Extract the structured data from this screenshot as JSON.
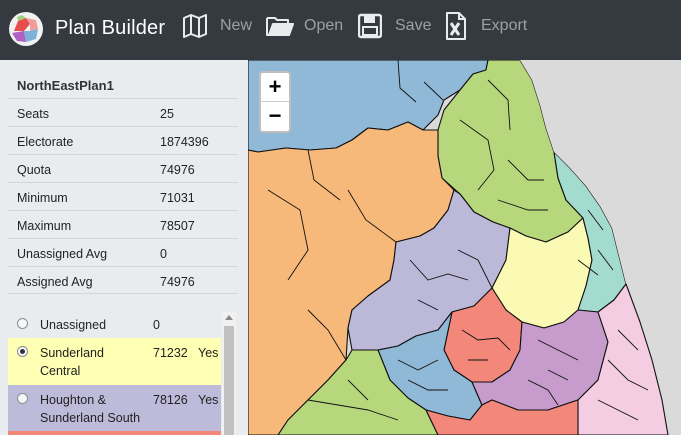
{
  "app": {
    "title": "Plan Builder"
  },
  "toolbar": {
    "new": "New",
    "open": "Open",
    "save": "Save",
    "export": "Export"
  },
  "plan": {
    "name": "NorthEastPlan1",
    "stats": [
      {
        "key": "Seats",
        "value": "25"
      },
      {
        "key": "Electorate",
        "value": "1874396"
      },
      {
        "key": "Quota",
        "value": "74976"
      },
      {
        "key": "Minimum",
        "value": "71031"
      },
      {
        "key": "Maximum",
        "value": "78507"
      },
      {
        "key": "Unassigned Avg",
        "value": "0"
      },
      {
        "key": "Assigned Avg",
        "value": "74976"
      }
    ]
  },
  "constituencies": [
    {
      "name": "Unassigned",
      "population": "0",
      "status": "",
      "color": "#e9ecef",
      "selected": false
    },
    {
      "name": "Sunderland Central",
      "population": "71232",
      "status": "Yes",
      "color": "#ffffb3",
      "selected": true
    },
    {
      "name": "Houghton & Sunderland South",
      "population": "78126",
      "status": "Yes",
      "color": "#bebada",
      "selected": false
    }
  ],
  "map": {
    "zoom_in": "+",
    "zoom_out": "−",
    "colors": {
      "blue": "#8fb9d6",
      "orange": "#f6b97a",
      "green": "#b6d77c",
      "lilac": "#bcb8d8",
      "yellow": "#fafab4",
      "teal": "#a3dccf",
      "salmon": "#f3887a",
      "purple": "#c79ccc",
      "pink": "#f5cde3",
      "grey": "#dadada"
    }
  }
}
